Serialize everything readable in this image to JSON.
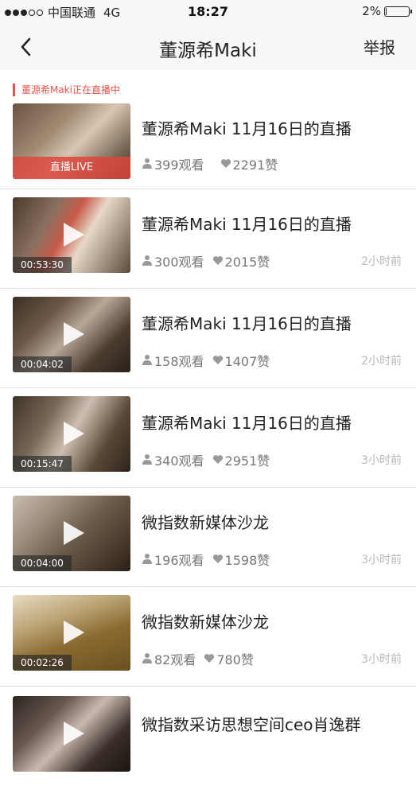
{
  "status_bar": {
    "carrier": "中国联通",
    "network": "4G",
    "time": "18:27",
    "battery": "2%",
    "battery_level": 0.02
  },
  "nav": {
    "title": "董源希Maki",
    "report_label": "举报"
  },
  "live_section_label": "董源希Maki正在直播中",
  "live_item": {
    "title": "董源希Maki 11月16日的直播",
    "views": "399观看",
    "likes": "2291赞",
    "badge": "直播LIVE"
  },
  "videos": [
    {
      "title": "董源希Maki 11月16日的直播",
      "views": "300观看",
      "likes": "2015赞",
      "duration": "00:53:30",
      "time_ago": "2小时前"
    },
    {
      "title": "董源希Maki 11月16日的直播",
      "views": "158观看",
      "likes": "1407赞",
      "duration": "00:04:02",
      "time_ago": "2小时前"
    },
    {
      "title": "董源希Maki 11月16日的直播",
      "views": "340观看",
      "likes": "2951赞",
      "duration": "00:15:47",
      "time_ago": "3小时前"
    },
    {
      "title": "微指数新媒体沙龙",
      "views": "196观看",
      "likes": "1598赞",
      "duration": "00:04:00",
      "time_ago": "3小时前"
    },
    {
      "title": "微指数新媒体沙龙",
      "views": "82观看",
      "likes": "780赞",
      "duration": "00:02:26",
      "time_ago": "3小时前"
    },
    {
      "title": "微指数采访思想空间ceo肖逸群"
    }
  ],
  "colors": {
    "accent": "#e8514a",
    "background": "#ffffff",
    "bar": "#f7f7f7"
  }
}
